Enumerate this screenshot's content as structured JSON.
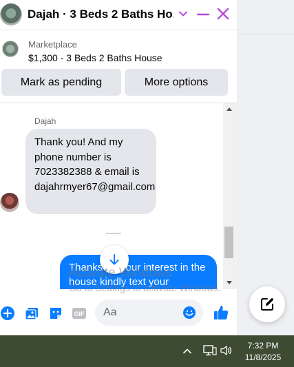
{
  "header": {
    "title": "Dajah · 3 Beds 2 Baths Ho...",
    "icons": [
      "chevron-down-icon",
      "minimize-icon",
      "close-icon"
    ]
  },
  "marketplace": {
    "label": "Marketplace",
    "listing": "$1,300 - 3 Beds 2 Baths House"
  },
  "actions": {
    "mark_pending": "Mark as pending",
    "more_options": "More options"
  },
  "messages": {
    "sender_name": "Dajah",
    "incoming_text": "Thank you! And my phone number is 7023382388 & email is dajahrmyer67@gmail.com",
    "outgoing_text": "Thanks for your interest in the house kindly text your"
  },
  "watermark": {
    "line1": "Activate Windows",
    "line2": "Go to Settings to activate Windows."
  },
  "composer": {
    "placeholder": "Aa",
    "icons": [
      "add-icon",
      "photo-icon",
      "sticker-icon",
      "gif-icon",
      "emoji-icon",
      "like-icon"
    ],
    "gif_label": "GIF"
  },
  "taskbar": {
    "time": "7:32 PM",
    "date": "11/8/2025"
  },
  "colors": {
    "accent": "#0a7cff",
    "header_icon": "#b44bd9",
    "bubble_in": "#e4e6eb"
  }
}
